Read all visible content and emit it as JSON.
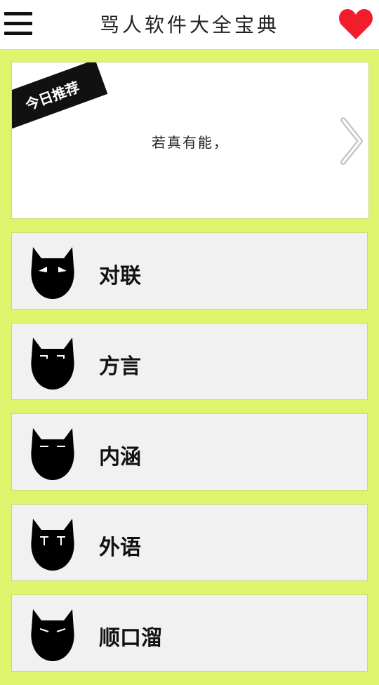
{
  "header": {
    "title": "骂人软件大全宝典",
    "menu_icon": "hamburger-menu-icon",
    "favorite_icon": "heart-icon",
    "favorite_color": "#f21d2a"
  },
  "featured": {
    "ribbon_label": "今日推荐",
    "text": "若真有能，",
    "next_icon": "chevron-right-icon"
  },
  "categories": [
    {
      "label": "对联",
      "icon": "angry-cat-icon"
    },
    {
      "label": "方言",
      "icon": "smirk-cat-icon"
    },
    {
      "label": "内涵",
      "icon": "flat-eyes-cat-icon"
    },
    {
      "label": "外语",
      "icon": "tt-cat-icon"
    },
    {
      "label": "顺口溜",
      "icon": "sly-cat-icon"
    }
  ],
  "colors": {
    "background": "#ddf46c",
    "card": "#f1f1f1",
    "ribbon": "#111111"
  }
}
